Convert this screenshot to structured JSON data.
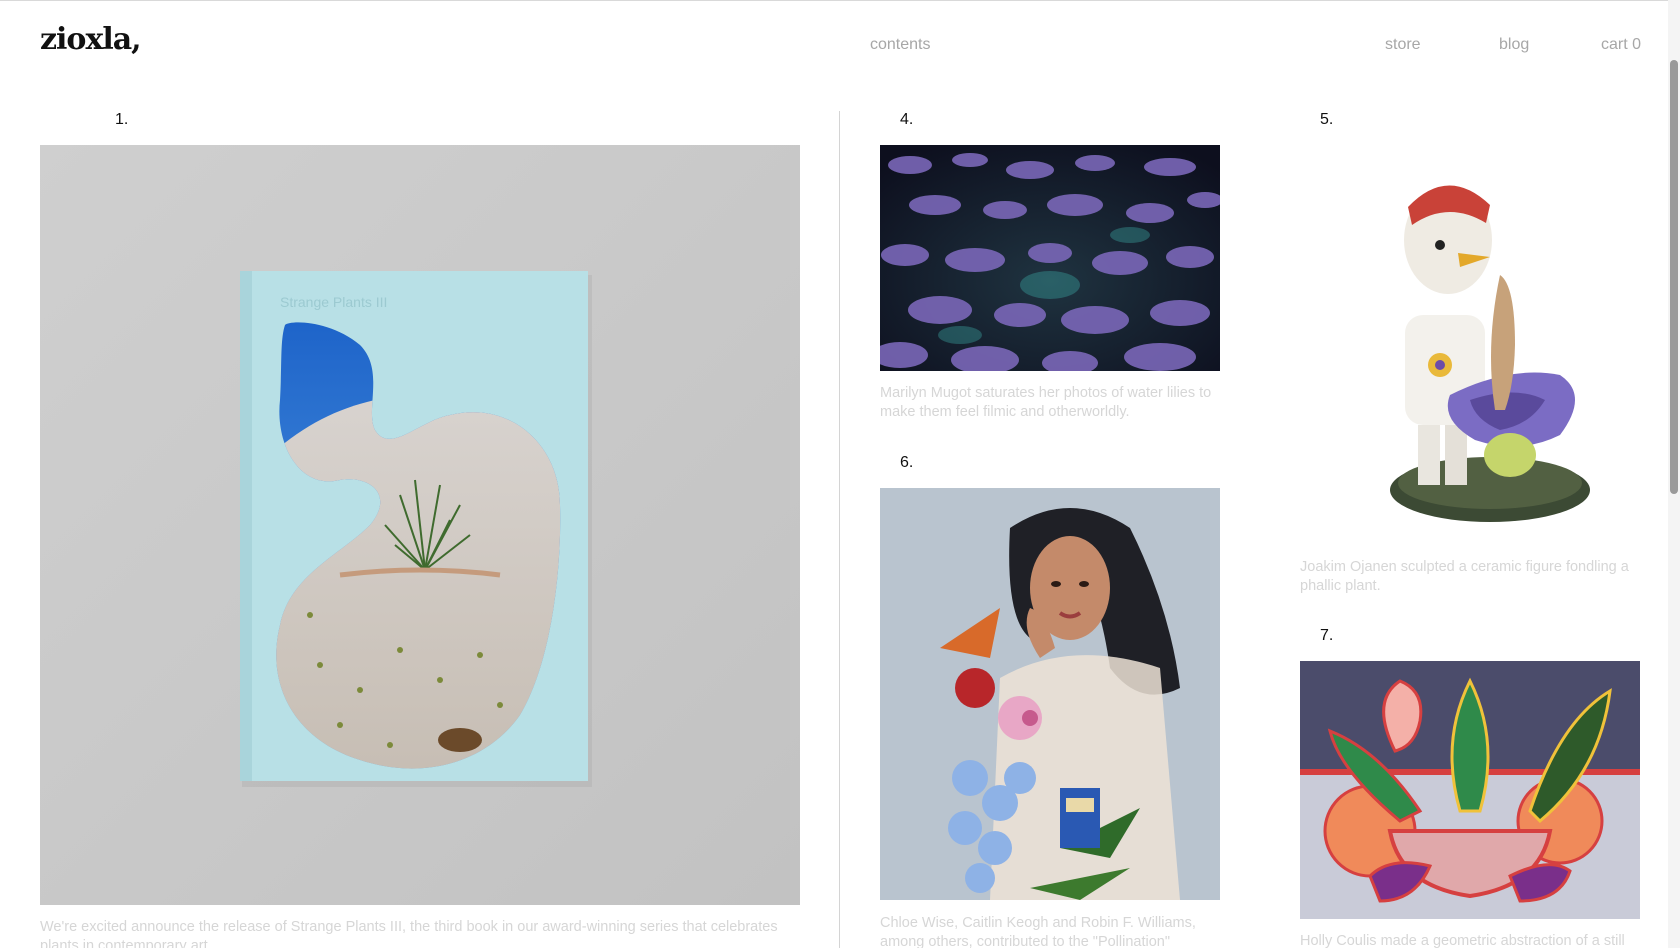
{
  "header": {
    "logo": "zioxla,",
    "nav": {
      "contents": "contents",
      "store": "store",
      "blog": "blog",
      "cart": "cart 0"
    }
  },
  "cards": [
    {
      "number": "1.",
      "book_title": "Strange Plants III",
      "caption": "We're excited announce the release of Strange Plants III, the third book in our award-winning series that celebrates plants in contemporary art."
    },
    {
      "number": "4.",
      "caption": "Marilyn Mugot saturates her photos of water lilies to make them feel filmic and otherworldly."
    },
    {
      "number": "5.",
      "caption": "Joakim Ojanen sculpted a ceramic figure fondling a phallic plant."
    },
    {
      "number": "6.",
      "caption": "Chloe Wise, Caitlin Keogh and Robin F. Williams, among others, contributed to the \"Pollination\""
    },
    {
      "number": "7.",
      "caption": "Holly Coulis made a geometric abstraction of a still"
    }
  ]
}
